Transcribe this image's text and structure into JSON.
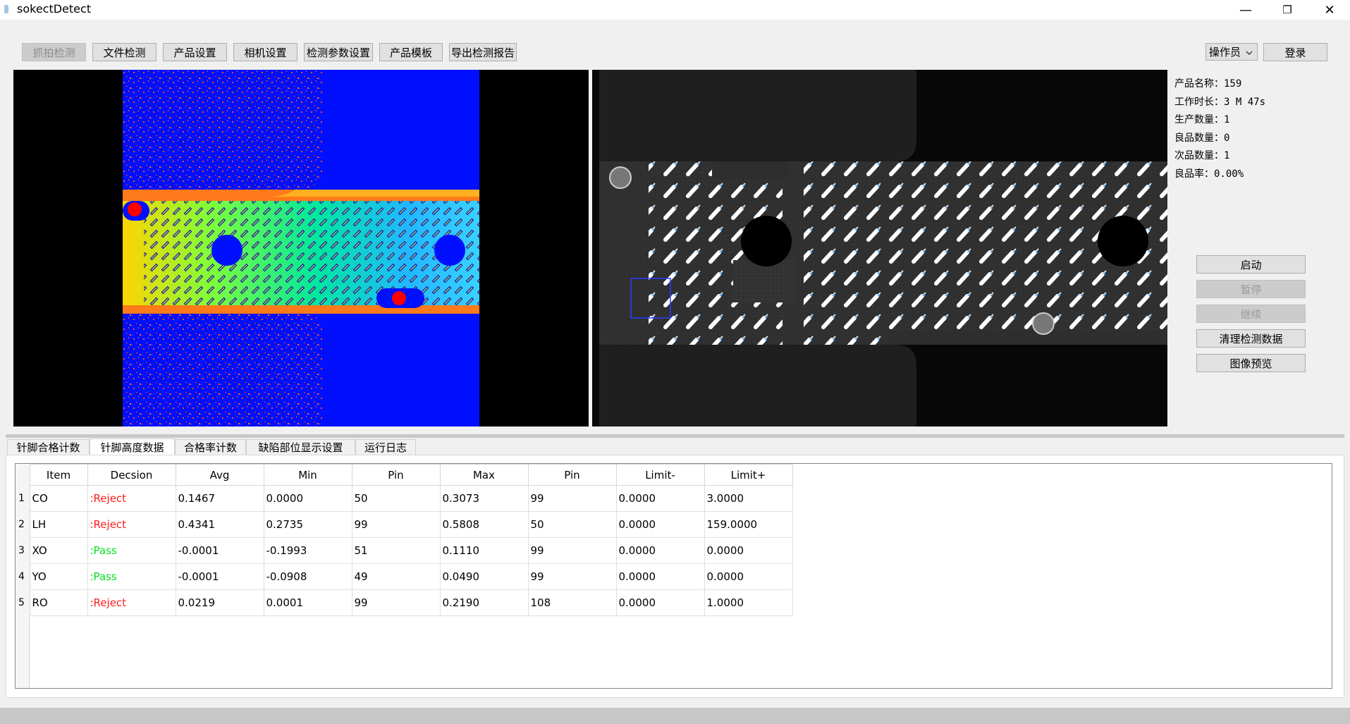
{
  "window": {
    "title": "sokectDetect",
    "min": "—",
    "restore": "❐",
    "close": "✕"
  },
  "toolbar": {
    "capture": "抓拍检测",
    "file_detect": "文件检测",
    "product_settings": "产品设置",
    "camera_settings": "相机设置",
    "detect_params": "检测参数设置",
    "product_template": "产品模板",
    "export_report": "导出检测报告"
  },
  "user": {
    "role": "操作员",
    "login": "登录"
  },
  "info": {
    "product_name": "产品名称：159",
    "work_time": "工作时长：3 M 47s",
    "produced": "生产数量：1",
    "good": "良品数量：0",
    "defect": "次品数量：1",
    "yield": "良品率：0.00%"
  },
  "controls": {
    "start": "启动",
    "pause": "暂停",
    "resume": "继续",
    "clear": "清理检测数据",
    "preview": "图像预览"
  },
  "tabs": [
    "针脚合格计数",
    "针脚高度数据",
    "合格率计数",
    "缺陷部位显示设置",
    "运行日志"
  ],
  "table": {
    "headers": [
      "Item",
      "Decsion",
      "Avg",
      "Min",
      "Pin",
      "Max",
      "Pin",
      "Limit-",
      "Limit+"
    ],
    "rows": [
      {
        "n": "1",
        "item": "CO",
        "decision": ":Reject",
        "avg": "0.1467",
        "min": "0.0000",
        "pin1": "50",
        "max": "0.3073",
        "pin2": "99",
        "lmin": "0.0000",
        "lmax": "3.0000"
      },
      {
        "n": "2",
        "item": "LH",
        "decision": ":Reject",
        "avg": "0.4341",
        "min": "0.2735",
        "pin1": "99",
        "max": "0.5808",
        "pin2": "50",
        "lmin": "0.0000",
        "lmax": "159.0000"
      },
      {
        "n": "3",
        "item": "XO",
        "decision": ":Pass",
        "avg": "-0.0001",
        "min": "-0.1993",
        "pin1": "51",
        "max": "0.1110",
        "pin2": "99",
        "lmin": "0.0000",
        "lmax": "0.0000"
      },
      {
        "n": "4",
        "item": "YO",
        "decision": ":Pass",
        "avg": "-0.0001",
        "min": "-0.0908",
        "pin1": "49",
        "max": "0.0490",
        "pin2": "99",
        "lmin": "0.0000",
        "lmax": "0.0000"
      },
      {
        "n": "5",
        "item": "RO",
        "decision": ":Reject",
        "avg": "0.0219",
        "min": "0.0001",
        "pin1": "99",
        "max": "0.2190",
        "pin2": "108",
        "lmin": "0.0000",
        "lmax": "1.0000"
      }
    ]
  },
  "colors": {
    "reject": "#ff1a1a",
    "pass": "#00e11e",
    "height_map_bg": "#0010ff"
  }
}
